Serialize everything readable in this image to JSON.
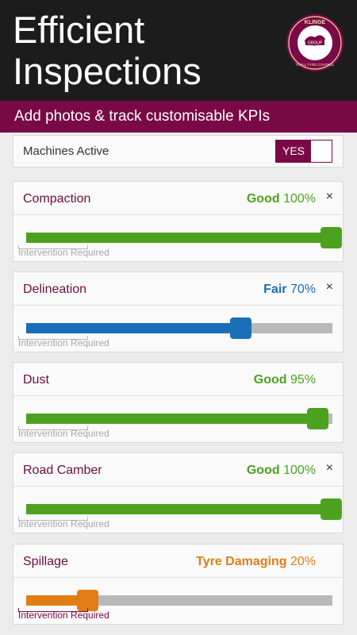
{
  "header": {
    "title_line1": "Efficient",
    "title_line2": "Inspections",
    "logo": {
      "top": "KLINGE",
      "middle": "GROUP",
      "bottom": "TOTAL TYRE CONTROL"
    }
  },
  "subtitle": "Add photos & track customisable KPIs",
  "machines": {
    "label": "Machines Active",
    "toggle_label": "YES",
    "enabled": true
  },
  "intervention_label": "Intervention Required",
  "colors": {
    "brand": "#7a0a45",
    "good": "#4ca21f",
    "fair": "#1a6eb8",
    "damaging": "#e07d14",
    "track": "#b9b9b9"
  },
  "kpis": [
    {
      "name": "Compaction",
      "rating": "Good",
      "percent": "100%",
      "value": 100,
      "color": "#4ca21f",
      "closable": true,
      "close": "×",
      "intervention": false
    },
    {
      "name": "Delineation",
      "rating": "Fair",
      "percent": "70%",
      "value": 70,
      "color": "#1a6eb8",
      "closable": true,
      "close": "×",
      "intervention": false
    },
    {
      "name": "Dust",
      "rating": "Good",
      "percent": "95%",
      "value": 95,
      "color": "#4ca21f",
      "closable": false,
      "close": "",
      "intervention": false
    },
    {
      "name": "Road Camber",
      "rating": "Good",
      "percent": "100%",
      "value": 100,
      "color": "#4ca21f",
      "closable": true,
      "close": "×",
      "intervention": false
    },
    {
      "name": "Spillage",
      "rating": "Tyre Damaging",
      "percent": "20%",
      "value": 20,
      "color": "#e07d14",
      "closable": false,
      "close": "",
      "intervention": true
    }
  ]
}
